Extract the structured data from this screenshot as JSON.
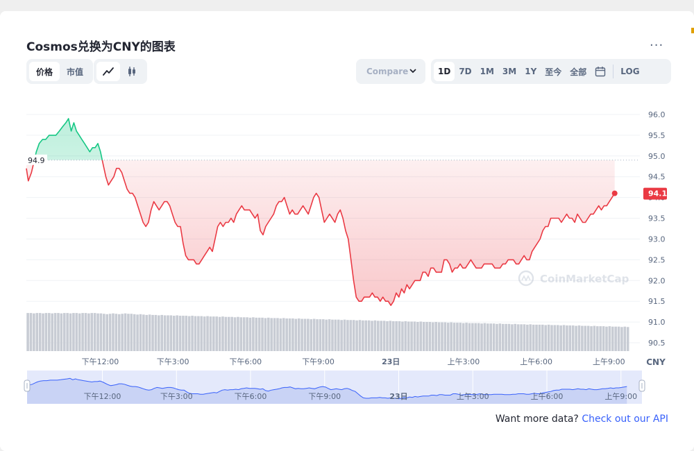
{
  "title": "Cosmos兑换为CNY的图表",
  "more_label": "...",
  "type_tabs": [
    {
      "label": "价格",
      "active": true
    },
    {
      "label": "市值",
      "active": false
    }
  ],
  "chart_type_tabs": [
    {
      "icon": "line-chart-icon",
      "active": true
    },
    {
      "icon": "candlestick-icon",
      "active": false
    }
  ],
  "compare": {
    "label": "Compare",
    "icon": "chevron-down-icon"
  },
  "range_tabs": [
    {
      "label": "1D",
      "active": true
    },
    {
      "label": "7D",
      "active": false
    },
    {
      "label": "1M",
      "active": false
    },
    {
      "label": "3M",
      "active": false
    },
    {
      "label": "1Y",
      "active": false
    },
    {
      "label": "至今",
      "active": false
    },
    {
      "label": "全部",
      "active": false
    }
  ],
  "calendar_icon": "calendar-icon",
  "log_label": "LOG",
  "watermark": "CoinMarketCap",
  "api_prompt": {
    "text": "Want more data?",
    "link": "Check out our API"
  },
  "colors": {
    "up": "#16c784",
    "down": "#ea3943",
    "accent": "#3861fb",
    "volume": "#c8ccd4"
  },
  "chart_data": {
    "type": "line",
    "currency_label": "CNY",
    "y_ticks": [
      "96.0",
      "95.5",
      "95.0",
      "94.5",
      "94.0",
      "93.5",
      "93.0",
      "92.5",
      "92.0",
      "91.5",
      "91.0",
      "90.5"
    ],
    "ylim": [
      90.3,
      96.25
    ],
    "x_tick_labels": [
      "下午12:00",
      "下午3:00",
      "下午6:00",
      "下午9:00",
      "23日",
      "上午3:00",
      "上午6:00",
      "上午9:00"
    ],
    "x_tick_times": [
      2,
      5,
      8,
      11,
      14,
      17,
      20,
      23
    ],
    "xlim": [
      -1.05,
      23.85
    ],
    "reference_price": 94.9,
    "reference_label": "94.9",
    "current_price": 94.1,
    "current_label": "94.1",
    "price_series": [
      [
        -1.05,
        94.7
      ],
      [
        -0.97,
        94.4
      ],
      [
        -0.84,
        94.6
      ],
      [
        -0.72,
        94.9
      ],
      [
        -0.64,
        95.1
      ],
      [
        -0.52,
        95.3
      ],
      [
        -0.38,
        95.4
      ],
      [
        -0.25,
        95.4
      ],
      [
        -0.11,
        95.5
      ],
      [
        0.03,
        95.5
      ],
      [
        0.17,
        95.5
      ],
      [
        0.31,
        95.6
      ],
      [
        0.44,
        95.7
      ],
      [
        0.58,
        95.8
      ],
      [
        0.69,
        95.9
      ],
      [
        0.8,
        95.6
      ],
      [
        0.91,
        95.8
      ],
      [
        1.02,
        95.6
      ],
      [
        1.13,
        95.5
      ],
      [
        1.24,
        95.4
      ],
      [
        1.35,
        95.3
      ],
      [
        1.46,
        95.2
      ],
      [
        1.57,
        95.1
      ],
      [
        1.68,
        95.2
      ],
      [
        1.79,
        95.2
      ],
      [
        1.9,
        95.3
      ],
      [
        2.01,
        95.1
      ],
      [
        2.12,
        94.8
      ],
      [
        2.23,
        94.5
      ],
      [
        2.34,
        94.3
      ],
      [
        2.45,
        94.4
      ],
      [
        2.56,
        94.5
      ],
      [
        2.67,
        94.7
      ],
      [
        2.78,
        94.7
      ],
      [
        2.89,
        94.6
      ],
      [
        3.0,
        94.4
      ],
      [
        3.11,
        94.2
      ],
      [
        3.22,
        94.1
      ],
      [
        3.33,
        94.1
      ],
      [
        3.44,
        94.0
      ],
      [
        3.55,
        93.8
      ],
      [
        3.66,
        93.6
      ],
      [
        3.77,
        93.4
      ],
      [
        3.88,
        93.3
      ],
      [
        3.99,
        93.4
      ],
      [
        4.1,
        93.7
      ],
      [
        4.21,
        93.9
      ],
      [
        4.32,
        93.8
      ],
      [
        4.43,
        93.7
      ],
      [
        4.54,
        93.8
      ],
      [
        4.65,
        93.9
      ],
      [
        4.76,
        93.9
      ],
      [
        4.87,
        93.8
      ],
      [
        4.98,
        93.6
      ],
      [
        5.09,
        93.4
      ],
      [
        5.2,
        93.3
      ],
      [
        5.31,
        93.3
      ],
      [
        5.42,
        92.9
      ],
      [
        5.53,
        92.6
      ],
      [
        5.64,
        92.5
      ],
      [
        5.75,
        92.5
      ],
      [
        5.86,
        92.5
      ],
      [
        5.97,
        92.4
      ],
      [
        6.08,
        92.4
      ],
      [
        6.19,
        92.5
      ],
      [
        6.3,
        92.6
      ],
      [
        6.41,
        92.7
      ],
      [
        6.52,
        92.8
      ],
      [
        6.63,
        92.7
      ],
      [
        6.74,
        93.0
      ],
      [
        6.85,
        93.3
      ],
      [
        6.96,
        93.4
      ],
      [
        7.07,
        93.3
      ],
      [
        7.18,
        93.4
      ],
      [
        7.29,
        93.4
      ],
      [
        7.4,
        93.5
      ],
      [
        7.51,
        93.4
      ],
      [
        7.62,
        93.6
      ],
      [
        7.73,
        93.7
      ],
      [
        7.84,
        93.8
      ],
      [
        7.95,
        93.7
      ],
      [
        8.06,
        93.7
      ],
      [
        8.17,
        93.7
      ],
      [
        8.28,
        93.6
      ],
      [
        8.39,
        93.5
      ],
      [
        8.5,
        93.6
      ],
      [
        8.61,
        93.2
      ],
      [
        8.72,
        93.1
      ],
      [
        8.83,
        93.3
      ],
      [
        8.94,
        93.4
      ],
      [
        9.05,
        93.5
      ],
      [
        9.16,
        93.6
      ],
      [
        9.27,
        93.8
      ],
      [
        9.38,
        93.9
      ],
      [
        9.49,
        93.9
      ],
      [
        9.6,
        94.0
      ],
      [
        9.71,
        93.8
      ],
      [
        9.82,
        93.6
      ],
      [
        9.93,
        93.7
      ],
      [
        10.04,
        93.6
      ],
      [
        10.15,
        93.6
      ],
      [
        10.26,
        93.7
      ],
      [
        10.37,
        93.8
      ],
      [
        10.48,
        93.7
      ],
      [
        10.59,
        93.6
      ],
      [
        10.7,
        93.8
      ],
      [
        10.81,
        94.0
      ],
      [
        10.92,
        94.1
      ],
      [
        11.03,
        94.0
      ],
      [
        11.14,
        93.7
      ],
      [
        11.25,
        93.4
      ],
      [
        11.36,
        93.5
      ],
      [
        11.47,
        93.6
      ],
      [
        11.58,
        93.5
      ],
      [
        11.69,
        93.4
      ],
      [
        11.8,
        93.6
      ],
      [
        11.91,
        93.7
      ],
      [
        12.02,
        93.5
      ],
      [
        12.13,
        93.2
      ],
      [
        12.24,
        93.0
      ],
      [
        12.35,
        92.5
      ],
      [
        12.46,
        92.0
      ],
      [
        12.57,
        91.6
      ],
      [
        12.68,
        91.5
      ],
      [
        12.79,
        91.5
      ],
      [
        12.9,
        91.6
      ],
      [
        13.01,
        91.6
      ],
      [
        13.12,
        91.6
      ],
      [
        13.23,
        91.7
      ],
      [
        13.34,
        91.6
      ],
      [
        13.45,
        91.6
      ],
      [
        13.56,
        91.5
      ],
      [
        13.67,
        91.6
      ],
      [
        13.78,
        91.5
      ],
      [
        13.89,
        91.5
      ],
      [
        14.0,
        91.4
      ],
      [
        14.11,
        91.5
      ],
      [
        14.22,
        91.7
      ],
      [
        14.33,
        91.6
      ],
      [
        14.44,
        91.8
      ],
      [
        14.55,
        91.7
      ],
      [
        14.66,
        91.9
      ],
      [
        14.77,
        91.8
      ],
      [
        14.88,
        91.9
      ],
      [
        14.99,
        92.0
      ],
      [
        15.1,
        92.0
      ],
      [
        15.21,
        92.0
      ],
      [
        15.32,
        92.2
      ],
      [
        15.43,
        92.2
      ],
      [
        15.54,
        92.1
      ],
      [
        15.65,
        92.3
      ],
      [
        15.76,
        92.3
      ],
      [
        15.87,
        92.2
      ],
      [
        15.98,
        92.2
      ],
      [
        16.09,
        92.2
      ],
      [
        16.2,
        92.5
      ],
      [
        16.31,
        92.5
      ],
      [
        16.42,
        92.4
      ],
      [
        16.53,
        92.2
      ],
      [
        16.64,
        92.3
      ],
      [
        16.75,
        92.3
      ],
      [
        16.86,
        92.4
      ],
      [
        16.97,
        92.3
      ],
      [
        17.08,
        92.3
      ],
      [
        17.19,
        92.4
      ],
      [
        17.3,
        92.5
      ],
      [
        17.41,
        92.4
      ],
      [
        17.52,
        92.3
      ],
      [
        17.63,
        92.3
      ],
      [
        17.74,
        92.3
      ],
      [
        17.85,
        92.4
      ],
      [
        17.96,
        92.4
      ],
      [
        18.07,
        92.4
      ],
      [
        18.18,
        92.4
      ],
      [
        18.29,
        92.3
      ],
      [
        18.4,
        92.3
      ],
      [
        18.51,
        92.3
      ],
      [
        18.62,
        92.4
      ],
      [
        18.73,
        92.4
      ],
      [
        18.84,
        92.5
      ],
      [
        18.95,
        92.5
      ],
      [
        19.06,
        92.5
      ],
      [
        19.17,
        92.4
      ],
      [
        19.28,
        92.4
      ],
      [
        19.39,
        92.5
      ],
      [
        19.5,
        92.6
      ],
      [
        19.61,
        92.5
      ],
      [
        19.72,
        92.5
      ],
      [
        19.83,
        92.7
      ],
      [
        19.94,
        92.8
      ],
      [
        20.05,
        92.9
      ],
      [
        20.16,
        93.0
      ],
      [
        20.27,
        93.2
      ],
      [
        20.38,
        93.3
      ],
      [
        20.49,
        93.3
      ],
      [
        20.6,
        93.5
      ],
      [
        20.71,
        93.5
      ],
      [
        20.82,
        93.5
      ],
      [
        20.93,
        93.5
      ],
      [
        21.04,
        93.4
      ],
      [
        21.15,
        93.5
      ],
      [
        21.26,
        93.6
      ],
      [
        21.37,
        93.5
      ],
      [
        21.48,
        93.5
      ],
      [
        21.59,
        93.4
      ],
      [
        21.7,
        93.6
      ],
      [
        21.81,
        93.5
      ],
      [
        21.92,
        93.4
      ],
      [
        22.03,
        93.4
      ],
      [
        22.14,
        93.5
      ],
      [
        22.25,
        93.6
      ],
      [
        22.36,
        93.6
      ],
      [
        22.47,
        93.7
      ],
      [
        22.58,
        93.8
      ],
      [
        22.69,
        93.7
      ],
      [
        22.8,
        93.8
      ],
      [
        22.91,
        93.8
      ],
      [
        23.02,
        93.9
      ],
      [
        23.13,
        94.0
      ],
      [
        23.24,
        94.1
      ]
    ],
    "volume_relative_to_max": [
      0.98,
      0.98,
      0.97,
      0.98,
      0.98,
      0.97,
      0.98,
      0.98,
      0.97,
      0.98,
      0.98,
      0.97,
      0.98,
      0.98,
      0.97,
      0.98,
      0.98,
      0.97,
      0.98,
      0.98,
      0.97,
      0.98,
      0.98,
      0.97,
      0.97,
      0.96,
      0.95,
      0.96,
      0.97,
      0.96,
      0.95,
      0.96,
      0.97,
      0.96,
      0.96,
      0.95,
      0.94,
      0.95,
      0.94,
      0.93,
      0.94,
      0.93,
      0.93,
      0.92,
      0.93,
      0.92,
      0.92,
      0.92,
      0.91,
      0.92,
      0.91,
      0.91,
      0.91,
      0.9,
      0.91,
      0.9,
      0.9,
      0.9,
      0.89,
      0.9,
      0.89,
      0.89,
      0.89,
      0.88,
      0.89,
      0.88,
      0.88,
      0.88,
      0.87,
      0.88,
      0.87,
      0.87,
      0.87,
      0.86,
      0.87,
      0.86,
      0.86,
      0.86,
      0.85,
      0.86,
      0.85,
      0.85,
      0.85,
      0.84,
      0.85,
      0.84,
      0.84,
      0.84,
      0.83,
      0.84,
      0.83,
      0.83,
      0.83,
      0.82,
      0.83,
      0.82,
      0.82,
      0.82,
      0.81,
      0.82,
      0.81,
      0.81,
      0.81,
      0.8,
      0.81,
      0.8,
      0.8,
      0.8,
      0.79,
      0.8,
      0.79,
      0.79,
      0.79,
      0.78,
      0.79,
      0.78,
      0.78,
      0.78,
      0.77,
      0.78,
      0.77,
      0.77,
      0.77,
      0.76,
      0.77,
      0.76,
      0.76,
      0.76,
      0.75,
      0.76,
      0.75,
      0.75,
      0.75,
      0.74,
      0.75,
      0.74,
      0.74,
      0.74,
      0.73,
      0.74,
      0.73,
      0.73,
      0.73,
      0.72,
      0.73,
      0.72,
      0.72,
      0.72,
      0.72,
      0.71,
      0.72,
      0.71,
      0.71,
      0.71,
      0.7,
      0.71,
      0.7,
      0.7,
      0.7,
      0.69,
      0.7,
      0.69,
      0.69,
      0.69,
      0.68,
      0.69,
      0.68,
      0.68,
      0.68,
      0.68,
      0.67,
      0.68,
      0.67,
      0.67,
      0.67,
      0.66,
      0.67,
      0.66,
      0.66,
      0.66,
      0.65,
      0.66,
      0.65,
      0.65,
      0.65,
      0.64,
      0.65,
      0.64,
      0.64,
      0.64,
      0.63,
      0.64,
      0.63,
      0.63,
      0.63,
      0.62,
      0.63,
      0.62
    ],
    "navigator_tick_labels": [
      "下午12:00",
      "下午3:00",
      "下午6:00",
      "下午9:00",
      "23日",
      "上午3:00",
      "上午6:00",
      "上午9:00"
    ]
  }
}
